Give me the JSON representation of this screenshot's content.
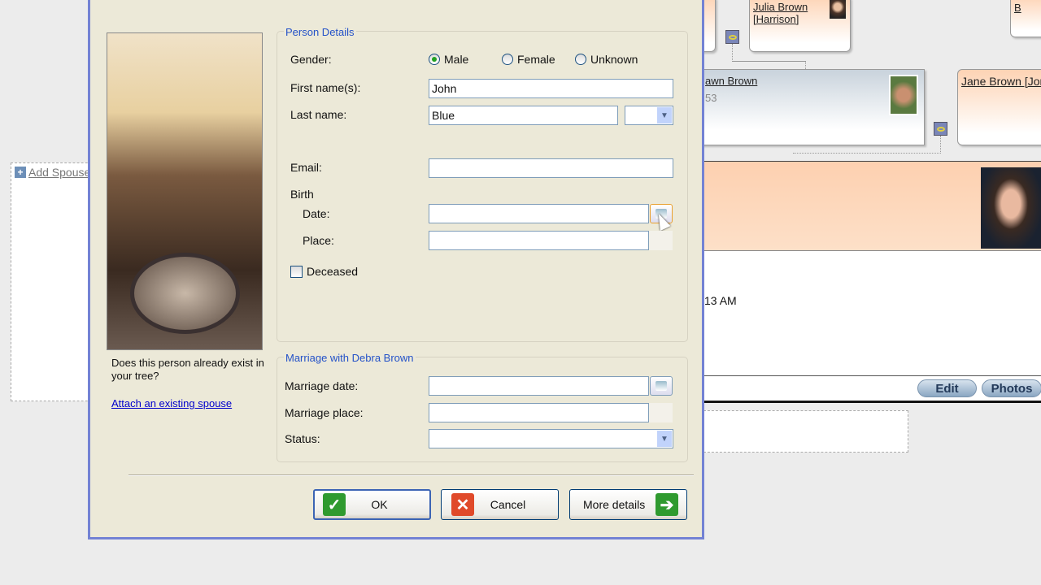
{
  "tree": {
    "add_spouse": "Add Spouse",
    "cards": [
      {
        "name": "Julia Brown",
        "name2": "[Harrison]"
      },
      {
        "name": "awn Brown",
        "detail": "53"
      },
      {
        "name": "Jane Brown [Jon"
      },
      {
        "name": "B"
      }
    ],
    "selected": {
      "time_text": "13 AM",
      "edit_label": "Edit",
      "photos_label": "Photos"
    }
  },
  "dialog": {
    "question": "Does this person already exist in your tree?",
    "attach_link": "Attach an existing spouse",
    "person_details": {
      "legend": "Person Details",
      "gender_label": "Gender:",
      "gender_options": [
        {
          "label": "Male",
          "selected": true
        },
        {
          "label": "Female",
          "selected": false
        },
        {
          "label": "Unknown",
          "selected": false
        }
      ],
      "first_name_label": "First name(s):",
      "first_name_value": "John",
      "last_name_label": "Last name:",
      "last_name_value": "Blue",
      "suffix_value": "",
      "email_label": "Email:",
      "email_value": "",
      "birth_label": "Birth",
      "date_label": "Date:",
      "date_value": "",
      "place_label": "Place:",
      "place_value": "",
      "deceased_label": "Deceased",
      "deceased_checked": false
    },
    "marriage": {
      "legend": "Marriage with Debra Brown",
      "date_label": "Marriage date:",
      "date_value": "",
      "place_label": "Marriage place:",
      "place_value": "",
      "status_label": "Status:",
      "status_value": ""
    },
    "buttons": {
      "ok": "OK",
      "cancel": "Cancel",
      "more": "More details"
    }
  },
  "colors": {
    "accent": "#2452c8",
    "dialog_border": "#7382d4",
    "ok_green": "#2f9a2f",
    "cancel_red": "#e04a2a"
  }
}
